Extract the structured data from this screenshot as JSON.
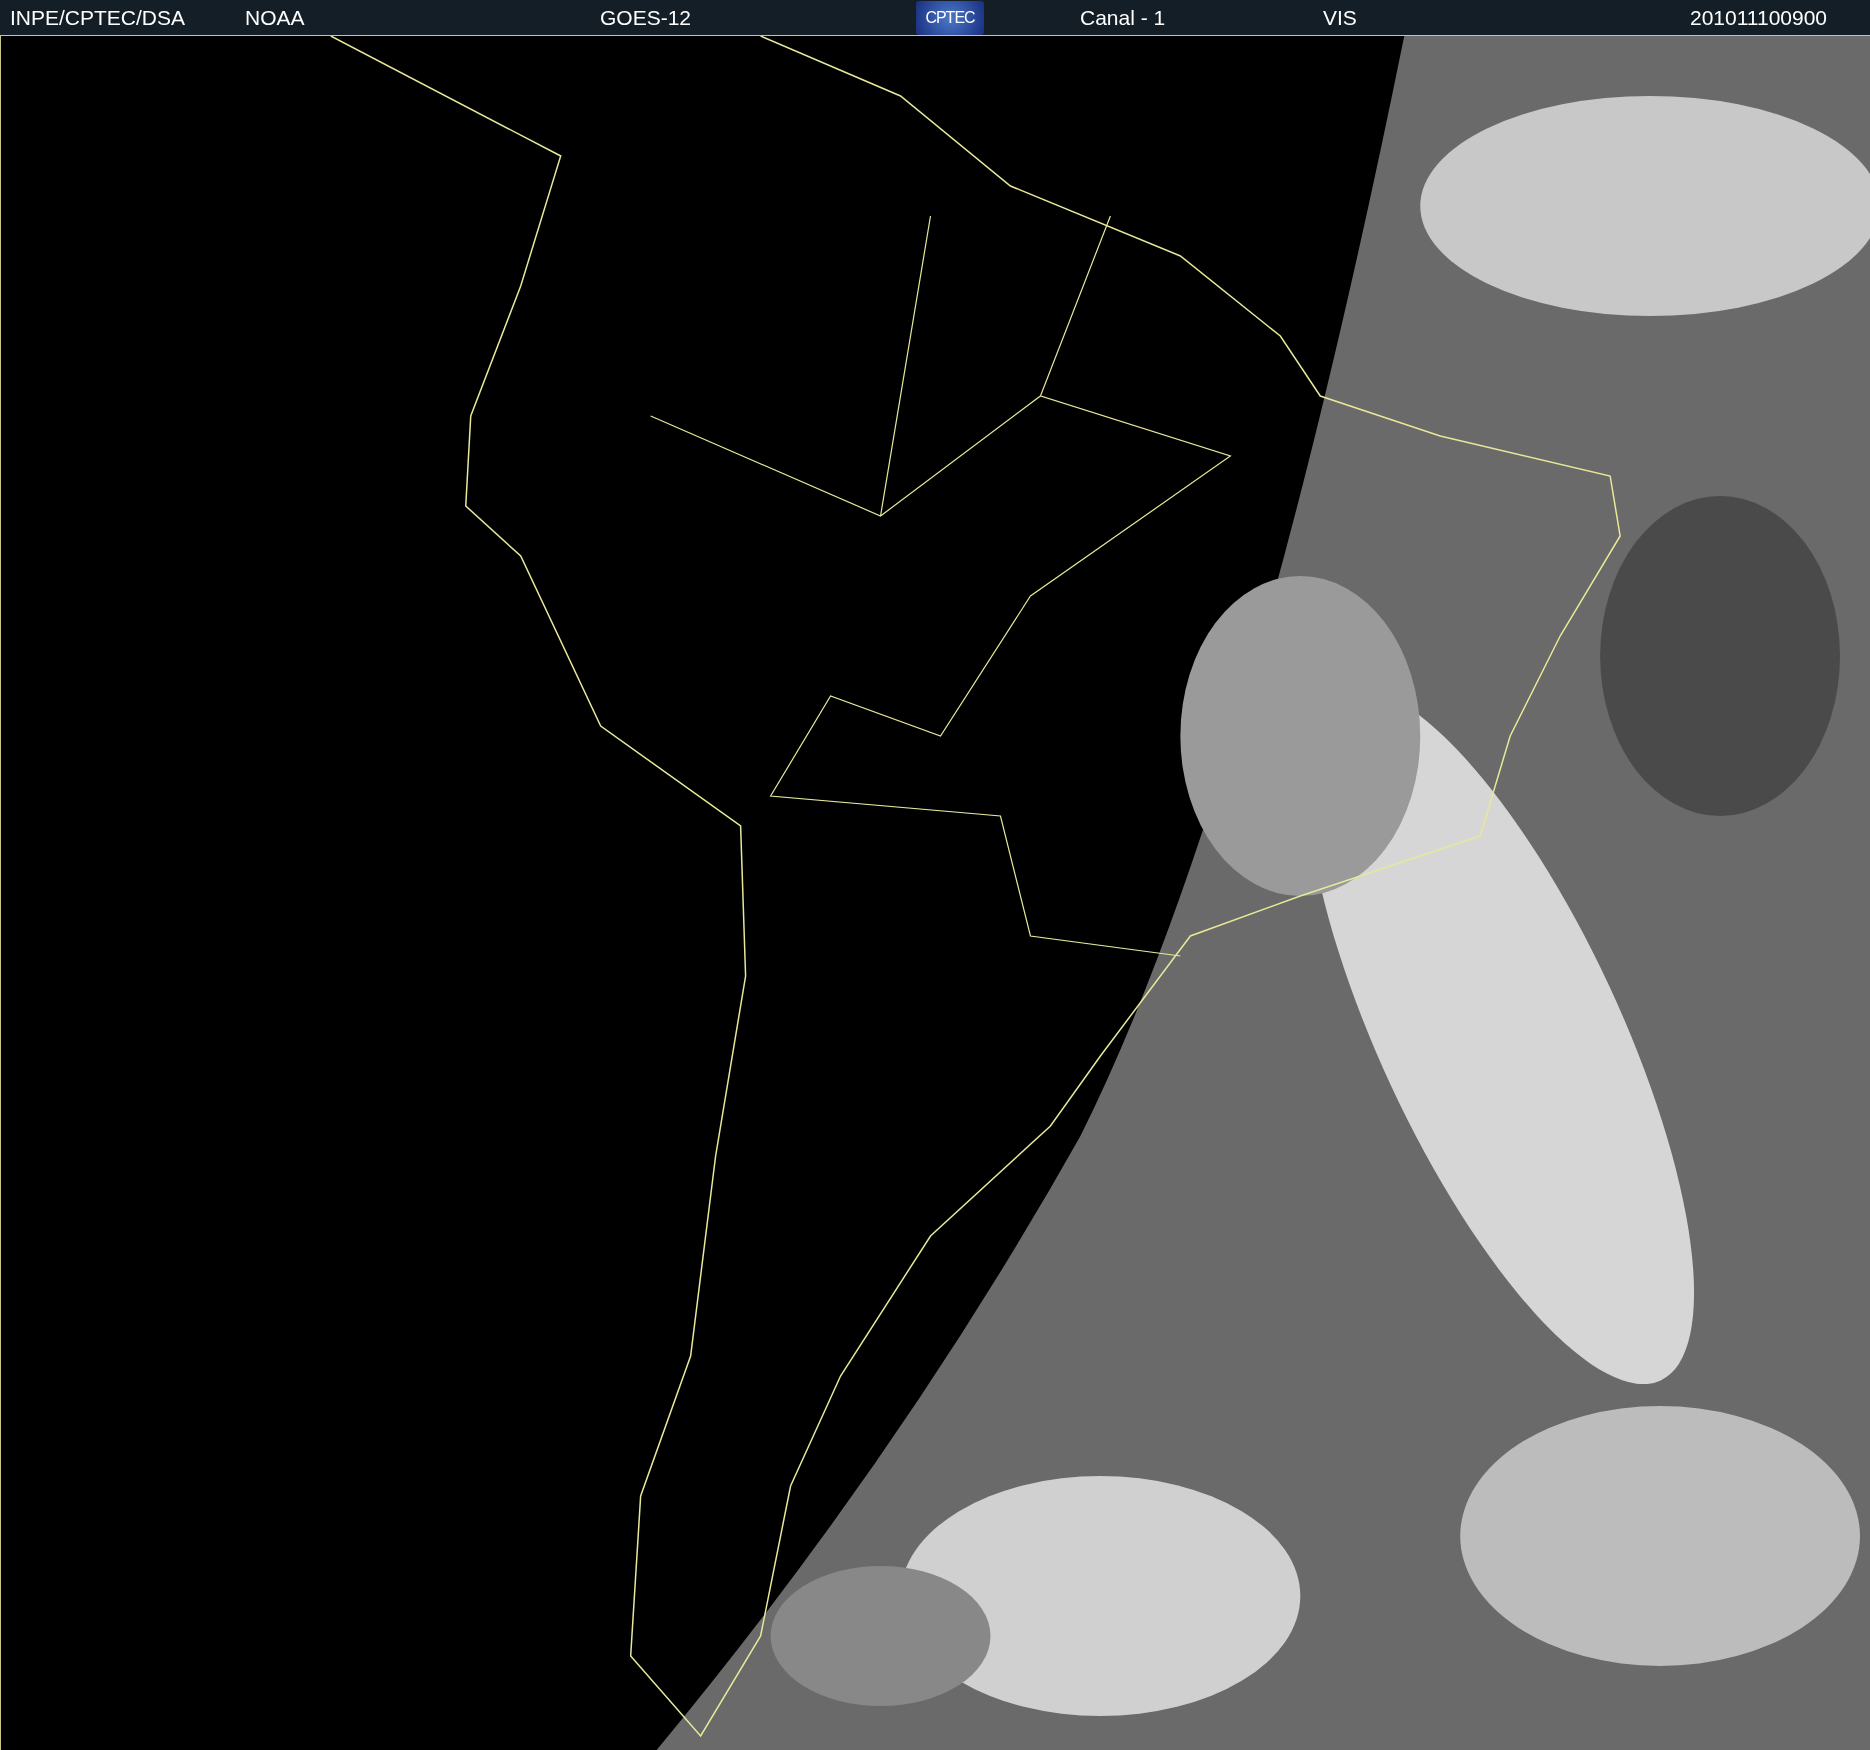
{
  "header": {
    "items": [
      {
        "kind": "text",
        "text": "INPE/CPTEC/DSA"
      },
      {
        "kind": "text",
        "text": "NOAA"
      },
      {
        "kind": "text",
        "text": "GOES-12"
      },
      {
        "kind": "logo",
        "text": "CPTEC"
      },
      {
        "kind": "text",
        "text": "Canal - 1"
      },
      {
        "kind": "text",
        "text": "VIS"
      },
      {
        "kind": "text",
        "text": "201011100900"
      }
    ]
  }
}
